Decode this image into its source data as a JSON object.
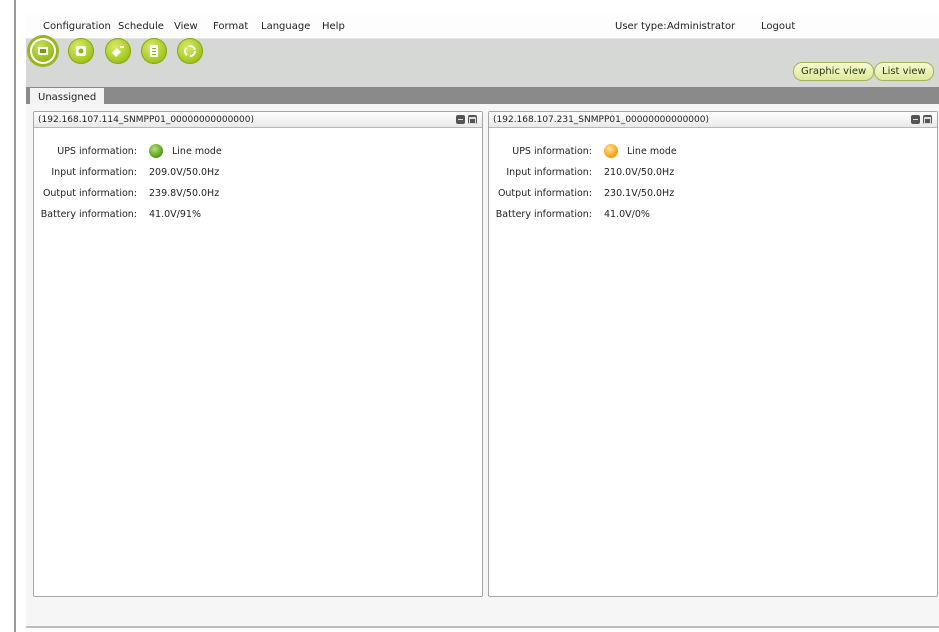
{
  "menu": [
    "Configuration",
    "Schedule",
    "View",
    "Format",
    "Language",
    "Help"
  ],
  "user": {
    "label": "User type:",
    "value": "Administrator",
    "logout": "Logout"
  },
  "toolbar": {
    "icons": [
      "device-icon",
      "settings-icon",
      "plug-icon",
      "log-icon",
      "refresh-icon"
    ],
    "graphic_view": "Graphic view",
    "list_view": "List view"
  },
  "tabs": [
    "Unassigned"
  ],
  "labels": {
    "ups": "UPS information:",
    "input": "Input information:",
    "output": "Output information:",
    "battery": "Battery information:"
  },
  "devices": [
    {
      "title": "(192.168.107.114_SNMPP01_00000000000000)",
      "status_color": "#5ea321",
      "mode": "Line mode",
      "input": "209.0V/50.0Hz",
      "output": "239.8V/50.0Hz",
      "battery": "41.0V/91%"
    },
    {
      "title": "(192.168.107.231_SNMPP01_00000000000000)",
      "status_color": "#f6a51a",
      "mode": "Line mode",
      "input": "210.0V/50.0Hz",
      "output": "230.1V/50.0Hz",
      "battery": "41.0V/0%"
    }
  ]
}
